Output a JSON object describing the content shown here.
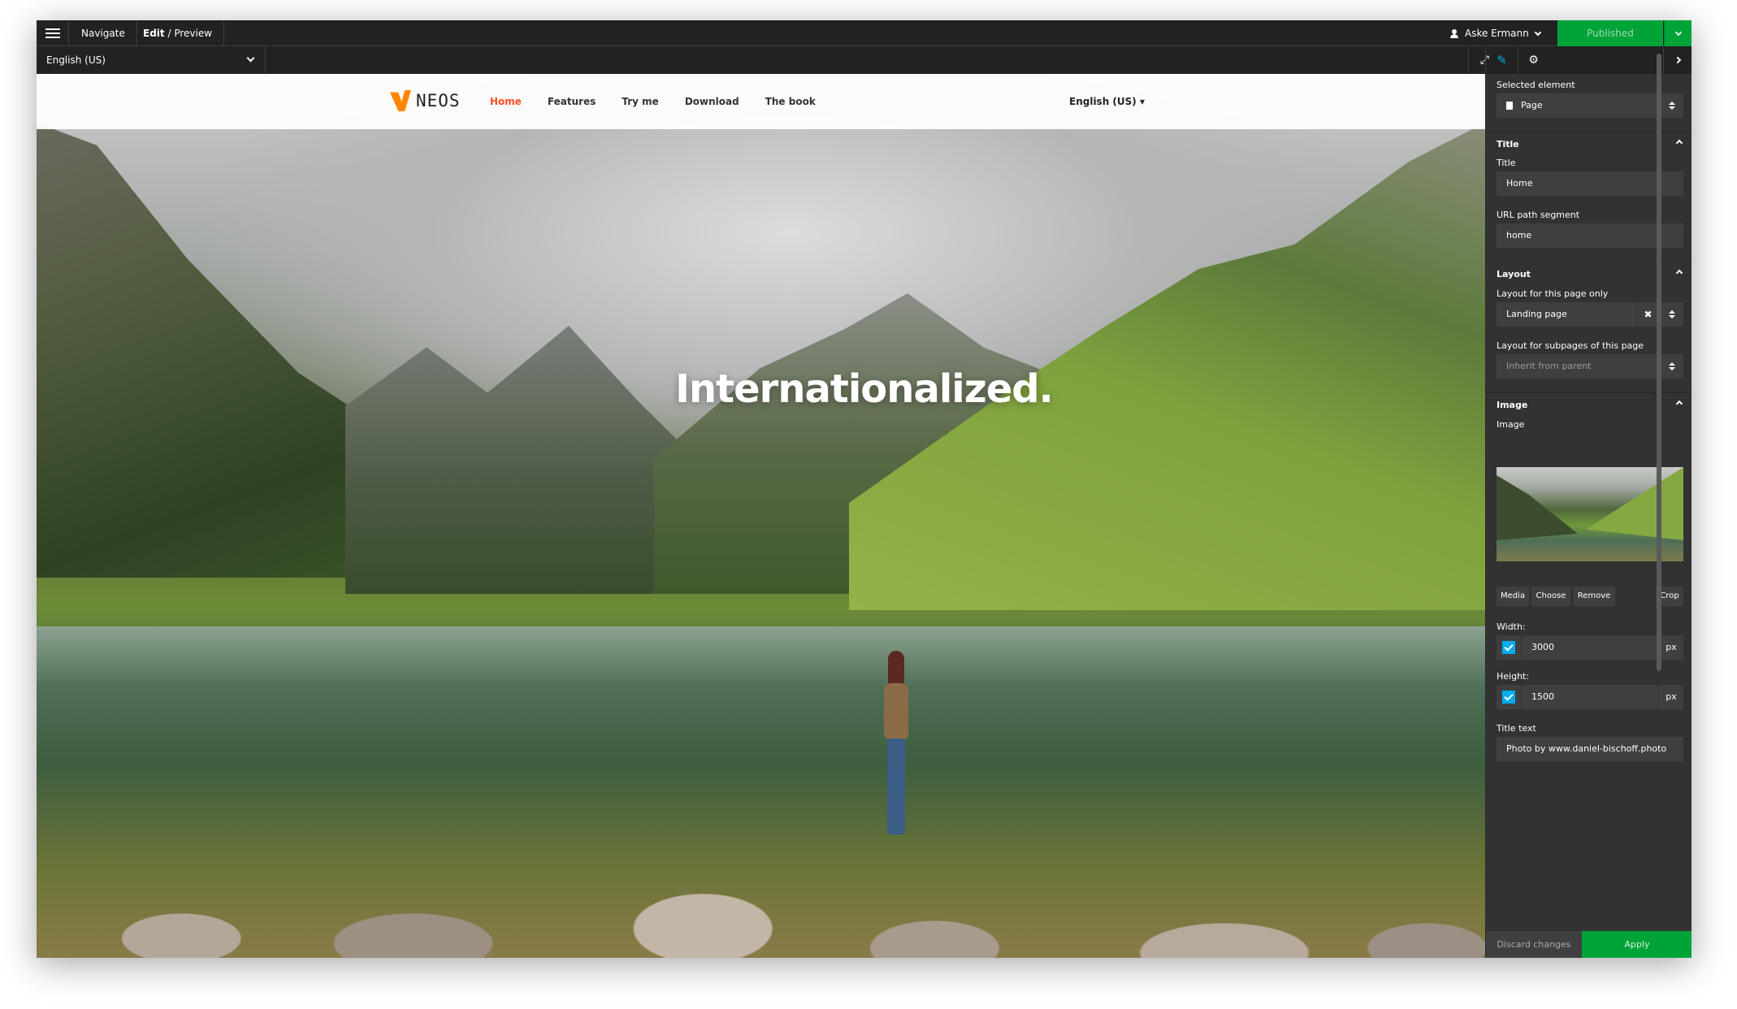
{
  "topbar": {
    "navigate_label": "Navigate",
    "edit_label": "Edit",
    "preview_label": " / Preview",
    "user_name": "Aske Ermann",
    "publish_label": "Published"
  },
  "secondbar": {
    "dimension_value": "English (US)"
  },
  "site": {
    "logo_text": "NEOS",
    "nav": [
      {
        "label": "Home",
        "active": true
      },
      {
        "label": "Features"
      },
      {
        "label": "Try me"
      },
      {
        "label": "Download"
      },
      {
        "label": "The book"
      }
    ],
    "language_label": "English (US) ▾",
    "hero_title": "Internationalized."
  },
  "inspector": {
    "selected_element_label": "Selected element",
    "selected_element_value": "Page",
    "title_group": "Title",
    "title_label": "Title",
    "title_value": "Home",
    "url_label": "URL path segment",
    "url_value": "home",
    "layout_group": "Layout",
    "layout_page_label": "Layout for this page only",
    "layout_page_value": "Landing page",
    "layout_sub_label": "Layout for subpages of this page",
    "layout_sub_value": "Inherit from parent",
    "image_group": "Image",
    "image_label": "Image",
    "buttons": {
      "media": "Media",
      "choose": "Choose",
      "remove": "Remove",
      "crop": "Crop"
    },
    "width_label": "Width:",
    "width_value": "3000",
    "height_label": "Height:",
    "height_value": "1500",
    "unit": "px",
    "title_text_label": "Title text",
    "title_text_value": "Photo by www.daniel-bischoff.photo",
    "discard_label": "Discard changes",
    "apply_label": "Apply"
  },
  "colors": {
    "brand": "#ff8700",
    "active_nav": "#ff4f22",
    "publish": "#00a338",
    "accent": "#00adee"
  }
}
